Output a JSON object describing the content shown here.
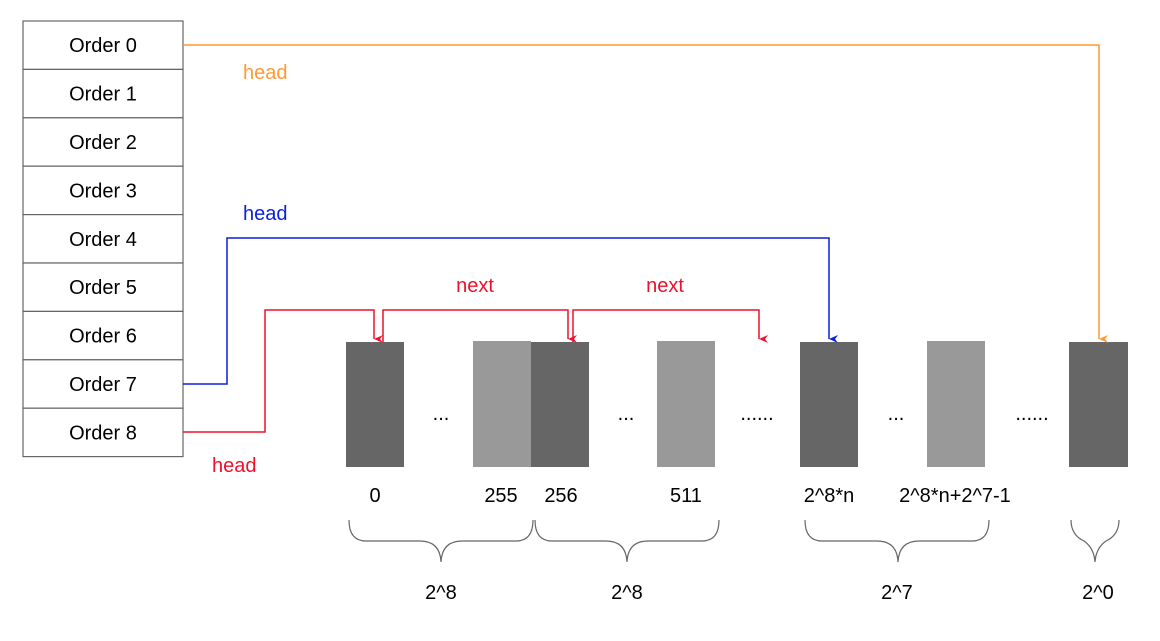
{
  "orders": [
    "Order 0",
    "Order 1",
    "Order 2",
    "Order 3",
    "Order 4",
    "Order 5",
    "Order 6",
    "Order 7",
    "Order 8"
  ],
  "colors": {
    "orange": "#ff9933",
    "blue": "#0a1fe0",
    "red": "#f0102a",
    "dark_block": "#666666",
    "light_block": "#999999",
    "table_border": "#666666",
    "brace": "#666666"
  },
  "labels": {
    "head_orange": "head",
    "head_blue": "head",
    "head_red": "head",
    "next_1": "next",
    "next_2": "next"
  },
  "ellipses": [
    "...",
    "...",
    "......",
    "...",
    "......"
  ],
  "block_indices": {
    "b0": "0",
    "b255": "255",
    "b256": "256",
    "b511": "511",
    "b2n": "2^8*n",
    "b2n_end": "2^8*n+2^7-1"
  },
  "brace_labels": [
    "2^8",
    "2^8",
    "2^7",
    "2^0"
  ]
}
